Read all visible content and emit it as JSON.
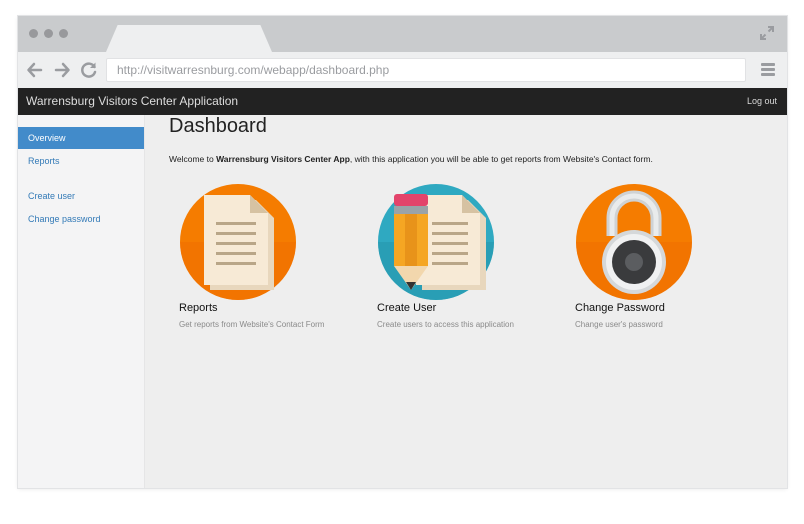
{
  "browser": {
    "url": "http://visitwarresnburg.com/webapp/dashboard.php"
  },
  "app": {
    "title": "Warrensburg Visitors Center Application",
    "logout_label": "Log out"
  },
  "sidebar": {
    "items": [
      {
        "label": "Overview",
        "active": true
      },
      {
        "label": "Reports"
      },
      {
        "label": "Create user"
      },
      {
        "label": "Change password"
      }
    ]
  },
  "main": {
    "title": "Dashboard",
    "welcome_prefix": "Welcome to ",
    "welcome_app": "Warrensburg Visitors Center App",
    "welcome_suffix": ", with this application you will be able to get reports from Website's Contact form.",
    "cards": [
      {
        "title": "Reports",
        "description": "Get reports from Website's Contact Form",
        "icon": "document-icon"
      },
      {
        "title": "Create User",
        "description": "Create users to access this application",
        "icon": "pencil-document-icon"
      },
      {
        "title": "Change Password",
        "description": "Change user's password",
        "icon": "padlock-icon"
      }
    ]
  },
  "colors": {
    "appbar": "#222222",
    "sidebar_active": "#428bca",
    "link": "#337ab7",
    "orange": "#f57c00",
    "teal": "#2fa9c1"
  }
}
